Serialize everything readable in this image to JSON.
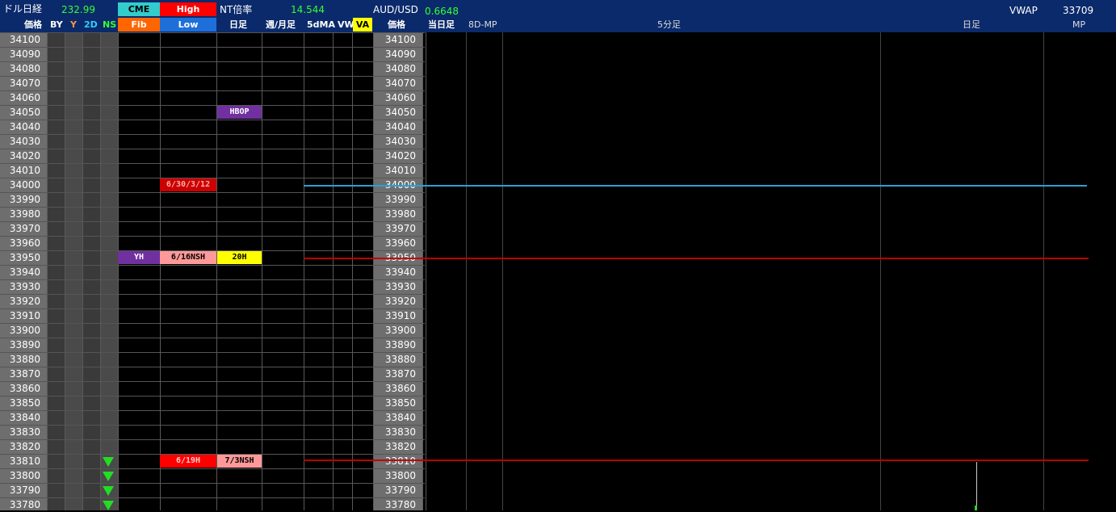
{
  "header": {
    "dollar_nikkei_label": "ドル日経",
    "dollar_nikkei_value": "232.99",
    "cme_label": "CME",
    "high_label": "High",
    "nt_label": "NT倍率",
    "nt_value": "14.544",
    "audusd_label": "AUD/USD",
    "audusd_value": "0.6648",
    "vwap_label": "VWAP",
    "vwap_value": "33709"
  },
  "columns": {
    "price": "価格",
    "by": "BY",
    "y": "Y",
    "two_d": "2D",
    "ns": "NS",
    "fib": "Fib",
    "low": "Low",
    "daily": "日足",
    "weekly_monthly": "週/月足",
    "ma5": "5dMA",
    "vw": "VW",
    "va": "VA",
    "price2": "価格",
    "today": "当日足",
    "mp8d": "8D-MP",
    "five_min": "5分足",
    "daily2": "日足",
    "mp": "MP"
  },
  "prices": [
    "34100",
    "34090",
    "34080",
    "34070",
    "34060",
    "34050",
    "34040",
    "34030",
    "34020",
    "34010",
    "34000",
    "33990",
    "33980",
    "33970",
    "33960",
    "33950",
    "33940",
    "33930",
    "33920",
    "33910",
    "33900",
    "33890",
    "33880",
    "33870",
    "33860",
    "33850",
    "33840",
    "33830",
    "33820",
    "33810",
    "33800",
    "33790",
    "33780"
  ],
  "tags": {
    "hbop": "HBOP",
    "high_marker": "6/30/3/12",
    "yh": "YH",
    "nsh_616": "6/16NSH",
    "h20": "20H",
    "h619": "6/19H",
    "nsh_78": "7/3NSH"
  },
  "colors": {
    "topbar": "#0b2a6b",
    "cme": "#33cccc",
    "high": "#ff0000",
    "fib": "#ff6600",
    "low": "#1e6fd9",
    "va": "#ffff00",
    "purple": "#7030a0",
    "pink": "#ff9999",
    "red_tag": "#cc0000",
    "line_blue": "#2a9fd6",
    "line_red": "#c00000",
    "triangle": "#22dd22"
  }
}
